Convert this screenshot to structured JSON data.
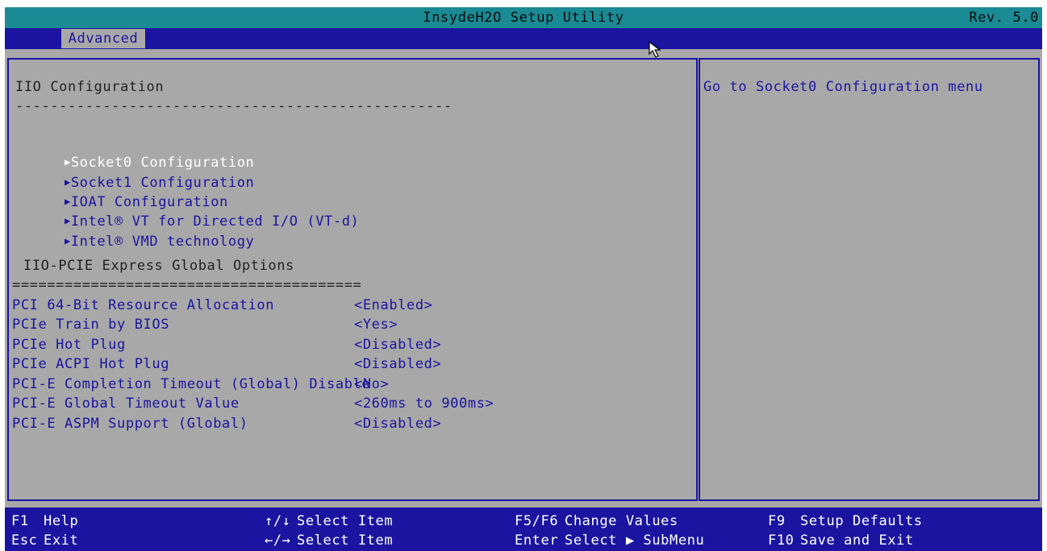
{
  "window": {
    "title": "InsydeH2O Setup Utility",
    "revision": "Rev. 5.0"
  },
  "tabs": [
    {
      "label": "Advanced",
      "selected": true
    }
  ],
  "main": {
    "section_title": "IIO Configuration",
    "section_divider": "--------------------------------------------------",
    "submenus": [
      {
        "label": "Socket0 Configuration",
        "selected": true
      },
      {
        "label": "Socket1 Configuration",
        "selected": false
      },
      {
        "label": "IOAT Configuration",
        "selected": false
      },
      {
        "label": "Intel® VT for Directed I/O (VT-d)",
        "selected": false
      },
      {
        "label": "Intel® VMD technology",
        "selected": false
      }
    ],
    "options_title": "IIO-PCIE Express Global Options",
    "options_divider": "========================================",
    "settings": [
      {
        "label": "PCI 64-Bit Resource Allocation",
        "value": "<Enabled>"
      },
      {
        "label": "PCIe Train by BIOS",
        "value": "<Yes>"
      },
      {
        "label": "PCIe Hot Plug",
        "value": "<Disabled>"
      },
      {
        "label": "PCIe ACPI Hot Plug",
        "value": "<Disabled>"
      },
      {
        "label": "PCI-E Completion Timeout (Global) Disable",
        "value": "<No>"
      },
      {
        "label": "PCI-E Global Timeout Value",
        "value": "<260ms to 900ms>"
      },
      {
        "label": "PCI-E ASPM Support (Global)",
        "value": "<Disabled>"
      }
    ]
  },
  "help_panel": {
    "text": "Go to Socket0 Configuration menu"
  },
  "footer": {
    "keys": [
      {
        "key": "F1",
        "action": "Help"
      },
      {
        "key": "Esc",
        "action": "Exit"
      },
      {
        "key": "↑/↓",
        "action": "Select Item"
      },
      {
        "key": "←/→",
        "action": "Select Item"
      },
      {
        "key": "F5/F6",
        "action": "Change Values"
      },
      {
        "key": "Enter",
        "action": "Select ▶ SubMenu"
      },
      {
        "key": "F9",
        "action": "Setup Defaults"
      },
      {
        "key": "F10",
        "action": "Save and Exit"
      }
    ]
  },
  "icons": {
    "submenu_arrow": "right-triangle-icon",
    "cursor": "mouse-pointer-icon"
  },
  "colors": {
    "title_bg": "#1a8a94",
    "menubar_bg": "#1a14a0",
    "panel_bg": "#a8a8a8",
    "text_blue": "#1a14a0",
    "selected_text": "#ffffff"
  }
}
